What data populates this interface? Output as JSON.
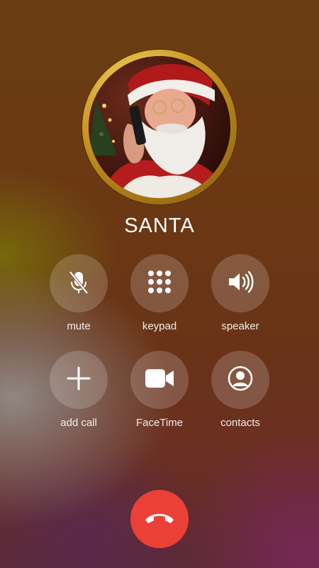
{
  "contact": {
    "name": "SANTA"
  },
  "buttons": {
    "mute": {
      "label": "mute",
      "icon": "mic-off-icon"
    },
    "keypad": {
      "label": "keypad",
      "icon": "keypad-icon"
    },
    "speaker": {
      "label": "speaker",
      "icon": "speaker-icon"
    },
    "add_call": {
      "label": "add call",
      "icon": "plus-icon"
    },
    "facetime": {
      "label": "FaceTime",
      "icon": "video-camera-icon"
    },
    "contacts": {
      "label": "contacts",
      "icon": "person-circle-icon"
    },
    "end_call": {
      "icon": "phone-hangup-icon"
    }
  },
  "colors": {
    "end_call": "#eb4036",
    "avatar_ring": "#c99521",
    "button_bg": "rgba(255,255,255,0.18)"
  }
}
